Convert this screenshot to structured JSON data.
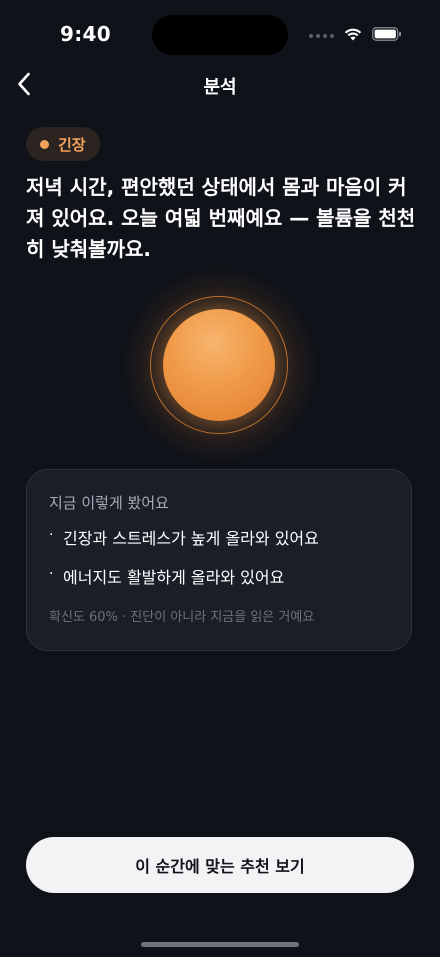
{
  "status_bar": {
    "time": "9:40"
  },
  "nav": {
    "title": "분석",
    "back_icon": "chevron-left-icon"
  },
  "state_chip": {
    "label": "긴장",
    "color": "#f2a35b"
  },
  "headline": "저녁 시간, 편안했던 상태에서 몸과 마음이 커져 있어요. 오늘 여덟 번째예요 — 볼륨을 천천히 낮춰볼까요.",
  "orb": {
    "color": "#f09a48"
  },
  "reading_card": {
    "title": "지금 이렇게 봤어요",
    "items": [
      "긴장과 스트레스가 높게 올라와 있어요",
      "에너지도 활발하게 올라와 있어요"
    ],
    "note": "확신도 60% · 진단이 아니라 지금을 읽은 거예요"
  },
  "cta": {
    "label": "이 순간에 맞는 추천 보기"
  },
  "colors": {
    "background": "#0f1219",
    "card": "#191e28",
    "accent": "#f2a35b",
    "button": "#f3f3f5"
  }
}
